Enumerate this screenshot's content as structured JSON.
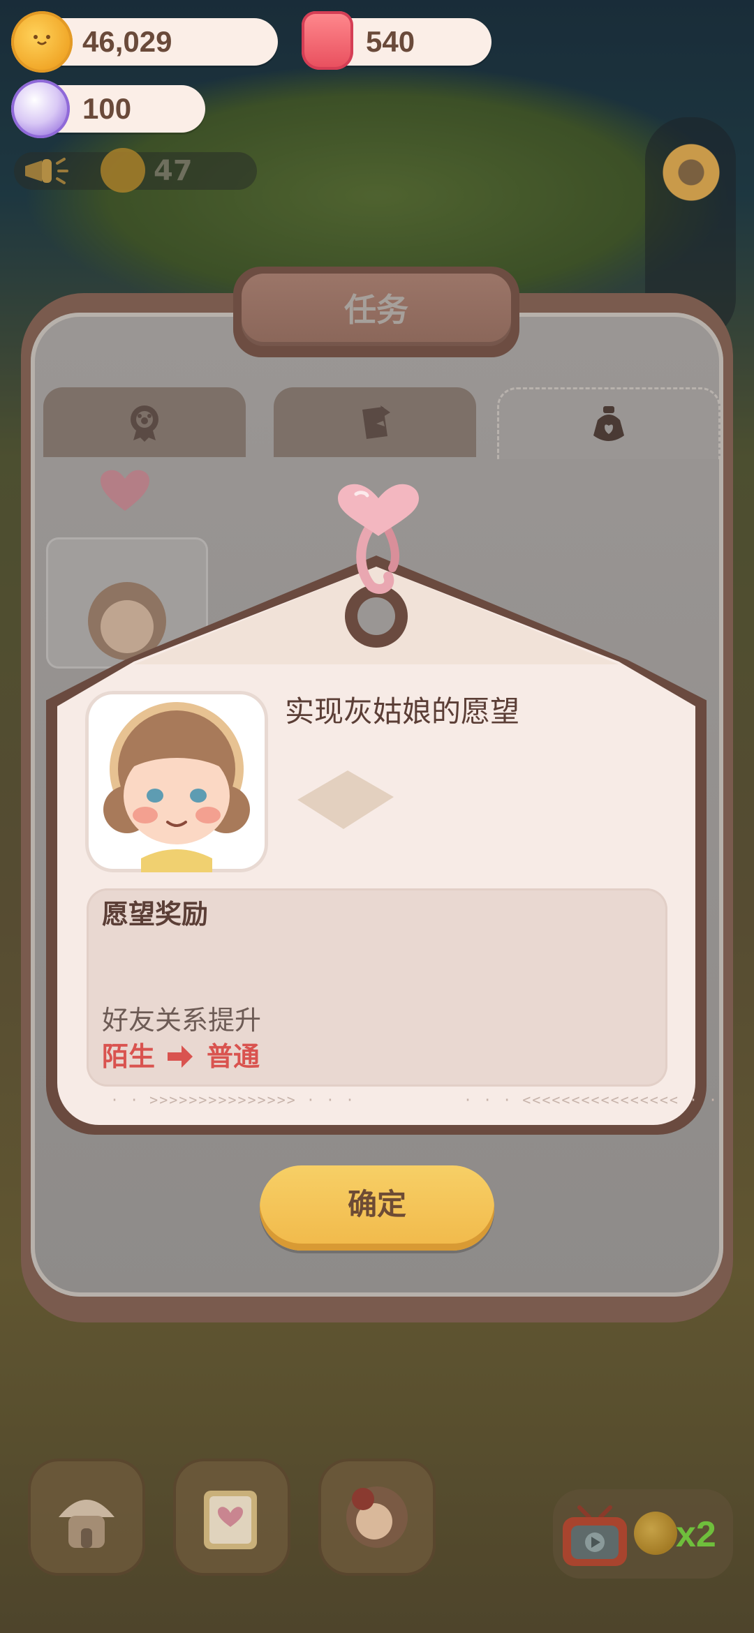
{
  "hud": {
    "cookies": {
      "value": "46,029",
      "icon": "cookie-coin-icon"
    },
    "jam": {
      "value": "540",
      "icon": "jam-jar-icon"
    },
    "candy": {
      "value": "100",
      "icon": "candy-icon"
    },
    "announce": {
      "value": "47",
      "icon": "megaphone-icon"
    },
    "settings_icon": "gear-icon"
  },
  "dialog": {
    "title": "任务",
    "tabs": [
      {
        "icon": "badge-icon",
        "active": false
      },
      {
        "icon": "clipboard-icon",
        "active": false
      },
      {
        "icon": "wish-bottle-icon",
        "active": true
      }
    ],
    "wish_card": {
      "title": "实现灰姑娘的愿望",
      "reward_header": "愿望奖励",
      "friendship_label": "好友关系提升",
      "relation_from": "陌生",
      "relation_to": "普通",
      "deco_left": "· · >>>>>>>>>>>>>>> · · ·",
      "deco_right": "· · · <<<<<<<<<<<<<<<< · ·"
    },
    "confirm_label": "确定"
  },
  "bottom_bar": {
    "buttons": [
      {
        "icon": "house-icon"
      },
      {
        "icon": "diary-icon"
      },
      {
        "icon": "character-icon"
      }
    ],
    "ad_multiplier": "x2"
  },
  "colors": {
    "accent_red": "#d9534f",
    "button_yellow": "#f1b94a",
    "frame_brown": "#6a4a3f",
    "card_cream": "#f7ebe6"
  }
}
